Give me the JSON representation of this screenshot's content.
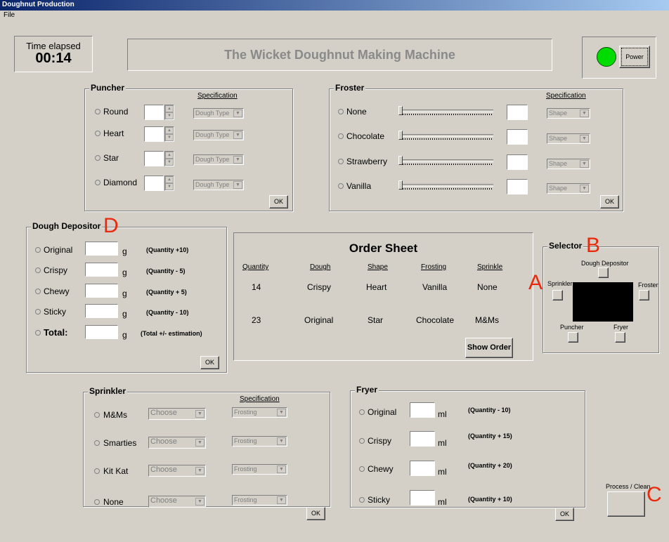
{
  "window": {
    "title": "Doughnut Production",
    "menu_file": "File"
  },
  "timer": {
    "label": "Time elapsed",
    "value": "00:14"
  },
  "banner": {
    "title": "The Wicket Doughnut Making Machine"
  },
  "power": {
    "label": "Power",
    "indicator_color": "#00dc00"
  },
  "puncher": {
    "title": "Puncher",
    "spec_header": "Specification",
    "options": [
      {
        "label": "Round",
        "dropdown": "Dough Type"
      },
      {
        "label": "Heart",
        "dropdown": "Dough Type"
      },
      {
        "label": "Star",
        "dropdown": "Dough Type"
      },
      {
        "label": "Diamond",
        "dropdown": "Dough Type"
      }
    ],
    "ok": "OK"
  },
  "froster": {
    "title": "Froster",
    "spec_header": "Specification",
    "options": [
      {
        "label": "None",
        "dropdown": "Shape"
      },
      {
        "label": "Chocolate",
        "dropdown": "Shape"
      },
      {
        "label": "Strawberry",
        "dropdown": "Shape"
      },
      {
        "label": "Vanilla",
        "dropdown": "Shape"
      }
    ],
    "ok": "OK"
  },
  "depositor": {
    "title": "Dough Depositor",
    "unit": "g",
    "options": [
      {
        "label": "Original",
        "note": "(Quantity +10)"
      },
      {
        "label": "Crispy",
        "note": "(Quantity - 5)"
      },
      {
        "label": "Chewy",
        "note": "(Quantity + 5)"
      },
      {
        "label": "Sticky",
        "note": "(Quantity - 10)"
      },
      {
        "label": "Total:",
        "note": "(Total +/- estimation)"
      }
    ],
    "ok": "OK"
  },
  "order_sheet": {
    "title": "Order Sheet",
    "headers": [
      "Quantity",
      "Dough",
      "Shape",
      "Frosting",
      "Sprinkle"
    ],
    "rows": [
      [
        "14",
        "Crispy",
        "Heart",
        "Vanilla",
        "None"
      ],
      [
        "23",
        "Original",
        "Star",
        "Chocolate",
        "M&Ms"
      ]
    ],
    "show_order": "Show Order"
  },
  "selector": {
    "title": "Selector",
    "dough_depositor": "Dough Depositor",
    "sprinkler": "Sprinkler",
    "froster": "Froster",
    "puncher": "Puncher",
    "fryer": "Fryer"
  },
  "sprinkler": {
    "title": "Sprinkler",
    "spec_header": "Specification",
    "options": [
      {
        "label": "M&Ms",
        "choose": "Choose",
        "frosting": "Frosting"
      },
      {
        "label": "Smarties",
        "choose": "Choose",
        "frosting": "Frosting"
      },
      {
        "label": "Kit Kat",
        "choose": "Choose",
        "frosting": "Frosting"
      },
      {
        "label": "None",
        "choose": "Choose",
        "frosting": "Frosting"
      }
    ],
    "ok": "OK"
  },
  "fryer": {
    "title": "Fryer",
    "unit": "ml",
    "options": [
      {
        "label": "Original",
        "note": "(Quantity - 10)"
      },
      {
        "label": "Crispy",
        "note": "(Quantity + 15)"
      },
      {
        "label": "Chewy",
        "note": "(Quantity + 20)"
      },
      {
        "label": "Sticky",
        "note": "(Quantity + 10)"
      }
    ],
    "ok": "OK"
  },
  "process": {
    "label": "Process / Clean"
  },
  "annotations": {
    "a": "A",
    "b": "B",
    "c": "C",
    "d": "D"
  }
}
